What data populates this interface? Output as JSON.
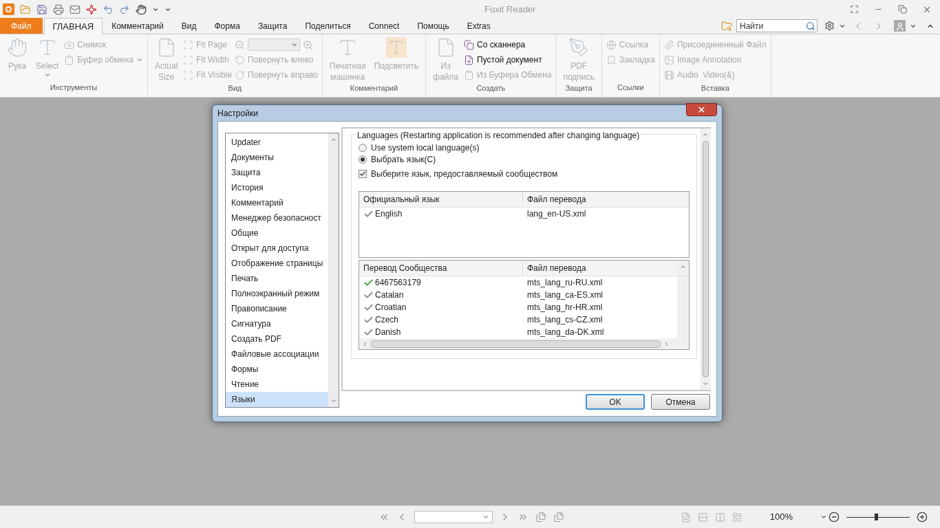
{
  "app_title": "Foxit Reader",
  "tabs": [
    {
      "label": "Файл",
      "kind": "file",
      "selected": false
    },
    {
      "label": "ГЛАВНАЯ",
      "kind": "tab",
      "selected": true
    },
    {
      "label": "Комментарий",
      "kind": "tab",
      "selected": false
    },
    {
      "label": "Вид",
      "kind": "tab",
      "selected": false
    },
    {
      "label": "Форма",
      "kind": "tab",
      "selected": false
    },
    {
      "label": "Защита",
      "kind": "tab",
      "selected": false
    },
    {
      "label": "Поделиться",
      "kind": "tab",
      "selected": false
    },
    {
      "label": "Connect",
      "kind": "tab",
      "selected": false
    },
    {
      "label": "Помощь",
      "kind": "tab",
      "selected": false
    },
    {
      "label": "Extras",
      "kind": "tab",
      "selected": false
    }
  ],
  "search": {
    "placeholder": "Найти"
  },
  "ribbon_groups": [
    {
      "title": "Инструменты",
      "columns": [
        {
          "kind": "large",
          "label": "Рука",
          "disabled": true,
          "dropdown": false
        },
        {
          "kind": "large",
          "label": "Select",
          "disabled": true,
          "dropdown": true
        },
        {
          "kind": "stack",
          "items": [
            {
              "kind": "button",
              "label": "Снимок",
              "disabled": true,
              "dropdown": false
            },
            {
              "kind": "button",
              "label": "Буфер обмена",
              "disabled": true,
              "dropdown": true
            }
          ]
        }
      ]
    },
    {
      "title": "Вид",
      "columns": [
        {
          "kind": "large",
          "label": "Actual\nSize",
          "disabled": true,
          "dropdown": false
        },
        {
          "kind": "stack",
          "items": [
            {
              "kind": "button",
              "label": "Fit Page",
              "disabled": true,
              "dropdown": false
            },
            {
              "kind": "button",
              "label": "Fit Width",
              "disabled": true,
              "dropdown": false
            },
            {
              "kind": "button",
              "label": "Fit Visible",
              "disabled": true,
              "dropdown": false
            }
          ]
        },
        {
          "kind": "stack",
          "items": [
            {
              "kind": "zoom",
              "disabled": true
            },
            {
              "kind": "button",
              "label": "Повернуть влево",
              "disabled": true,
              "dropdown": false
            },
            {
              "kind": "button",
              "label": "Повернуть вправо",
              "disabled": true,
              "dropdown": false
            }
          ]
        }
      ]
    },
    {
      "title": "Комментарий",
      "columns": [
        {
          "kind": "large",
          "label": "Печатная\nмашинка",
          "disabled": true,
          "dropdown": false
        },
        {
          "kind": "large",
          "label": "Подсветить",
          "disabled": true,
          "dropdown": false
        }
      ]
    },
    {
      "title": "Создать",
      "columns": [
        {
          "kind": "large",
          "label": "Из\nфайла",
          "disabled": true,
          "dropdown": false
        },
        {
          "kind": "stack",
          "items": [
            {
              "kind": "button",
              "label": "Со сканнера",
              "disabled": false,
              "dropdown": false
            },
            {
              "kind": "button",
              "label": "Пустой документ",
              "disabled": false,
              "dropdown": false
            },
            {
              "kind": "button",
              "label": "Из Буфера Обмена",
              "disabled": true,
              "dropdown": false
            }
          ]
        }
      ]
    },
    {
      "title": "Защита",
      "columns": [
        {
          "kind": "large",
          "label": "PDF\nподпись",
          "disabled": true,
          "dropdown": false
        }
      ]
    },
    {
      "title": "Ссылки",
      "columns": [
        {
          "kind": "stack",
          "items": [
            {
              "kind": "button",
              "label": "Ссылка",
              "disabled": true,
              "dropdown": false
            },
            {
              "kind": "button",
              "label": "Закладка",
              "disabled": true,
              "dropdown": false
            }
          ]
        }
      ]
    },
    {
      "title": "Вставка",
      "columns": [
        {
          "kind": "stack",
          "items": [
            {
              "kind": "button",
              "label": "Присоединенный Файл",
              "disabled": true,
              "dropdown": false
            },
            {
              "kind": "button",
              "label": "Image Annotation",
              "disabled": true,
              "dropdown": false
            },
            {
              "kind": "button",
              "label": "Audio  Video(&)",
              "disabled": true,
              "dropdown": false
            }
          ]
        }
      ]
    }
  ],
  "dialog": {
    "title": "Настройки",
    "categories": [
      {
        "label": "Updater",
        "selected": false
      },
      {
        "label": "Документы",
        "selected": false
      },
      {
        "label": "Защита",
        "selected": false
      },
      {
        "label": "История",
        "selected": false
      },
      {
        "label": "Комментарий",
        "selected": false
      },
      {
        "label": "Менеджер безопасност",
        "selected": false
      },
      {
        "label": "Общие",
        "selected": false
      },
      {
        "label": "Открыт для доступа",
        "selected": false
      },
      {
        "label": "Отображение страницы",
        "selected": false
      },
      {
        "label": "Печать",
        "selected": false
      },
      {
        "label": "Полноэкранный режим",
        "selected": false
      },
      {
        "label": "Правописание",
        "selected": false
      },
      {
        "label": "Сигнатура",
        "selected": false
      },
      {
        "label": "Создать PDF",
        "selected": false
      },
      {
        "label": "Файловые ассоциации",
        "selected": false
      },
      {
        "label": "Формы",
        "selected": false
      },
      {
        "label": "Чтение",
        "selected": false
      },
      {
        "label": "Языки",
        "selected": true
      }
    ],
    "group_title": "Languages (Restarting application is recommended after changing language)",
    "radios": [
      {
        "label": "Use system local language(s)",
        "selected": false
      },
      {
        "label": "Выбрать язык(C)",
        "selected": true
      }
    ],
    "checkbox": {
      "label": "Выберите язык, предоставляемый сообществом",
      "checked": true
    },
    "official_table": {
      "columns": [
        "Официальный язык",
        "Файл перевода"
      ],
      "rows": [
        {
          "language": "English",
          "file": "lang_en-US.xml",
          "selected": false
        }
      ]
    },
    "community_table": {
      "columns": [
        "Перевод Сообщества",
        "Файл перевода"
      ],
      "rows": [
        {
          "language": "6467563179",
          "file": "mts_lang_ru-RU.xml",
          "selected": true
        },
        {
          "language": "Catalan",
          "file": "mts_lang_ca-ES.xml",
          "selected": false
        },
        {
          "language": "Croatian",
          "file": "mts_lang_hr-HR.xml",
          "selected": false
        },
        {
          "language": "Czech",
          "file": "mts_lang_cs-CZ.xml",
          "selected": false
        },
        {
          "language": "Danish",
          "file": "mts_lang_da-DK.xml",
          "selected": false
        }
      ]
    },
    "buttons": [
      {
        "label": "OK",
        "kind": "default"
      },
      {
        "label": "Отмена",
        "kind": "normal"
      }
    ]
  },
  "status_bar": {
    "zoom": "100%",
    "zoom_slider": {
      "level": 0.47
    }
  }
}
